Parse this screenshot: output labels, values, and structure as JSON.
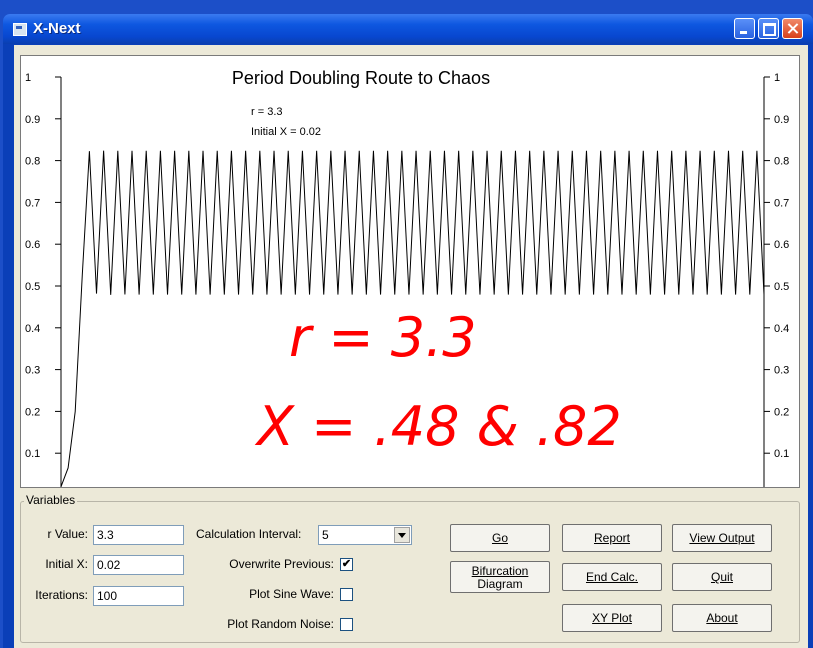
{
  "window": {
    "title": "X-Next"
  },
  "chart_data": {
    "type": "line",
    "title": "Period Doubling Route to Chaos",
    "annotation_lines": [
      "r = 3.3",
      "Initial X = 0.02"
    ],
    "ylim": [
      0,
      1
    ],
    "yticks": [
      "1",
      "0.9",
      "0.8",
      "0.7",
      "0.6",
      "0.5",
      "0.4",
      "0.3",
      "0.2",
      "0.1"
    ],
    "x_points": 100,
    "series": [
      {
        "r": 3.3,
        "x0": 0.02,
        "values_note_high": 0.82,
        "values_note_low": 0.48
      }
    ],
    "overlay": {
      "line1": "r = 3.3",
      "line2": "X = .48 & .82",
      "color": "#ff0000"
    }
  },
  "variables": {
    "group_label": "Variables",
    "r_value_label": "r Value:",
    "r_value": "3.3",
    "initial_x_label": "Initial X:",
    "initial_x": "0.02",
    "iterations_label": "Iterations:",
    "iterations": "100",
    "calc_interval_label": "Calculation Interval:",
    "calc_interval": "5",
    "overwrite_label": "Overwrite Previous:",
    "overwrite_checked": "✔",
    "sine_label": "Plot Sine Wave:",
    "noise_label": "Plot Random Noise:"
  },
  "buttons": {
    "go": "Go",
    "report": "Report",
    "view_output": "View Output",
    "bifurcation_1": "Bifurcation",
    "bifurcation_2": "Diagram",
    "end_calc": "End Calc.",
    "quit": "Quit",
    "xy_plot": "XY Plot",
    "about": "About"
  },
  "colors": {
    "titlebar": "#0a56e0",
    "overlay_text": "#ff0000",
    "face": "#ece9d8"
  }
}
